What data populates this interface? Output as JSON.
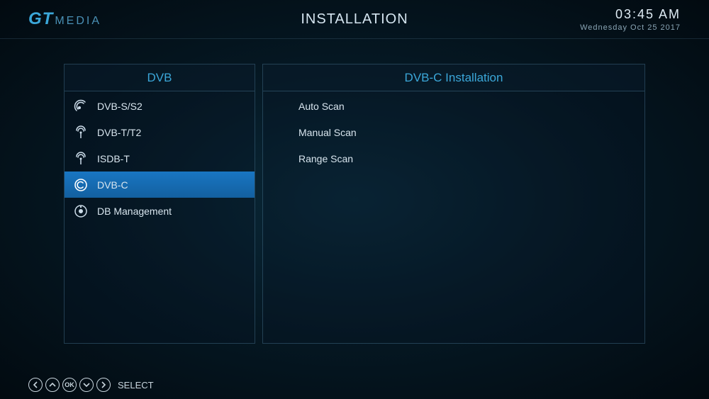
{
  "brand": {
    "prefix": "GT",
    "suffix": "MEDIA"
  },
  "pageTitle": "INSTALLATION",
  "clock": {
    "time": "03:45 AM",
    "date": "Wednesday Oct 25 2017"
  },
  "leftPanel": {
    "title": "DVB",
    "items": [
      {
        "label": "DVB-S/S2",
        "icon": "satellite"
      },
      {
        "label": "DVB-T/T2",
        "icon": "antenna"
      },
      {
        "label": "ISDB-T",
        "icon": "antenna"
      },
      {
        "label": "DVB-C",
        "icon": "cable",
        "selected": true
      },
      {
        "label": "DB Management",
        "icon": "db"
      }
    ]
  },
  "rightPanel": {
    "title": "DVB-C Installation",
    "items": [
      {
        "label": "Auto Scan"
      },
      {
        "label": "Manual Scan"
      },
      {
        "label": "Range Scan"
      }
    ]
  },
  "footer": {
    "icons": [
      "left",
      "up",
      "ok",
      "down",
      "right"
    ],
    "okLabel": "OK",
    "label": "SELECT"
  }
}
